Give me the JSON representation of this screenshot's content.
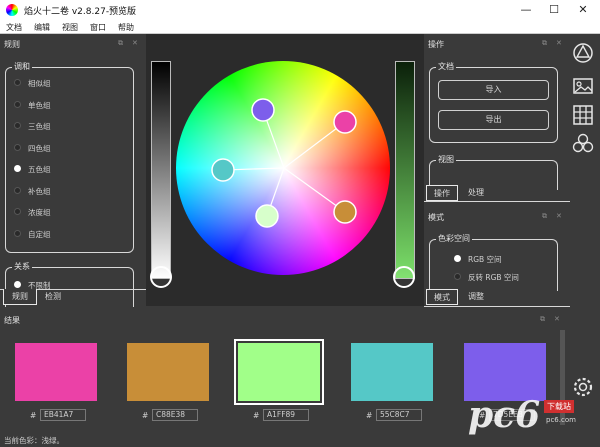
{
  "window": {
    "title": "焰火十二卷 v2.8.27-预览版",
    "minimize": "—",
    "maximize": "☐",
    "close": "✕"
  },
  "menu": {
    "items": [
      "文档",
      "编辑",
      "视图",
      "窗口",
      "帮助"
    ]
  },
  "rules_panel": {
    "title": "规则",
    "harmony": {
      "title": "调和",
      "options": [
        "相似组",
        "单色组",
        "三色组",
        "四色组",
        "五色组",
        "补色组",
        "浓度组",
        "自定组"
      ],
      "selected_index": 4
    },
    "relation": {
      "title": "关系",
      "option": "不限制"
    },
    "tabs": [
      "规则",
      "检测"
    ],
    "active_tab": 0
  },
  "operations_panel": {
    "title": "操作",
    "document": {
      "title": "文档",
      "import_label": "导入",
      "export_label": "导出"
    },
    "view": {
      "title": "视图"
    },
    "tabs": [
      "操作",
      "处理"
    ],
    "active_tab": 0
  },
  "mode_panel": {
    "title": "模式",
    "color_space": {
      "title": "色彩空间",
      "options": [
        "RGB 空间",
        "反转 RGB 空间"
      ],
      "selected_index": 0
    },
    "tabs": [
      "模式",
      "调整"
    ],
    "active_tab": 0
  },
  "results_panel": {
    "title": "结果",
    "hash": "#",
    "swatches": [
      {
        "hex": "EB41A7",
        "color": "#EB41A7",
        "selected": false
      },
      {
        "hex": "C88E38",
        "color": "#C88E38",
        "selected": false
      },
      {
        "hex": "A1FF89",
        "color": "#A1FF89",
        "selected": true
      },
      {
        "hex": "55C8C7",
        "color": "#55C8C7",
        "selected": false
      },
      {
        "hex": "7D5EEB",
        "color": "#7D5EEB",
        "selected": false
      }
    ]
  },
  "status": {
    "text": "当前色彩：浅绿。"
  },
  "side_icons": [
    "color-wheel-icon",
    "image-icon",
    "grid-icon",
    "harmony-icon",
    "settings-icon"
  ],
  "watermark": {
    "text": "pc6",
    "badge": "下载站",
    "url": "pc6.com"
  },
  "colors": {
    "background": "#3a3a3a",
    "canvas": "#2b2b2b",
    "accent_green": "#7CE06A"
  }
}
